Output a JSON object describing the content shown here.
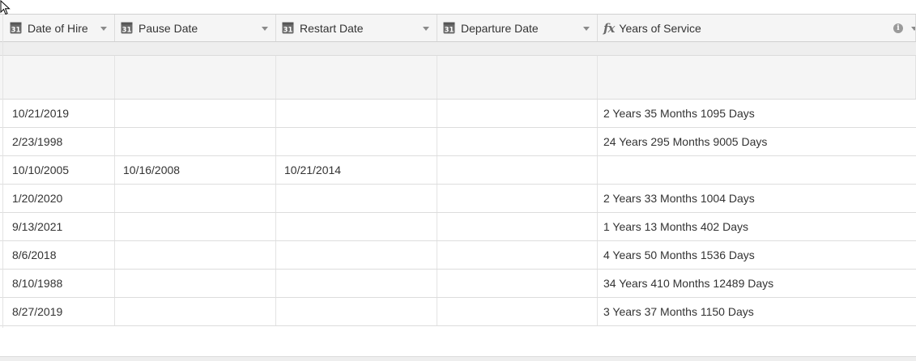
{
  "columns": [
    {
      "label": "Date of Hire",
      "icon": "calendar-icon",
      "icon_text": "31"
    },
    {
      "label": "Pause Date",
      "icon": "calendar-icon",
      "icon_text": "31"
    },
    {
      "label": "Restart Date",
      "icon": "calendar-icon",
      "icon_text": "31"
    },
    {
      "label": "Departure Date",
      "icon": "calendar-icon",
      "icon_text": "31"
    },
    {
      "label": "Years of Service",
      "icon": "formula-icon",
      "icon_text": "fx"
    }
  ],
  "info_icon_text": "i",
  "rows": [
    {
      "hire": "10/21/2019",
      "pause": "",
      "restart": "",
      "departure": "",
      "service": "2 Years 35 Months 1095 Days"
    },
    {
      "hire": "2/23/1998",
      "pause": "",
      "restart": "",
      "departure": "",
      "service": "24 Years 295 Months 9005 Days"
    },
    {
      "hire": "10/10/2005",
      "pause": "10/16/2008",
      "restart": "10/21/2014",
      "departure": "",
      "service": ""
    },
    {
      "hire": "1/20/2020",
      "pause": "",
      "restart": "",
      "departure": "",
      "service": "2 Years 33 Months 1004 Days"
    },
    {
      "hire": "9/13/2021",
      "pause": "",
      "restart": "",
      "departure": "",
      "service": "1 Years 13 Months 402 Days"
    },
    {
      "hire": "8/6/2018",
      "pause": "",
      "restart": "",
      "departure": "",
      "service": "4 Years 50 Months 1536 Days"
    },
    {
      "hire": "8/10/1988",
      "pause": "",
      "restart": "",
      "departure": "",
      "service": "34 Years 410 Months 12489 Days"
    },
    {
      "hire": "8/27/2019",
      "pause": "",
      "restart": "",
      "departure": "",
      "service": "3 Years 37 Months 1150 Days"
    }
  ],
  "colors": {
    "header_bg": "#f5f5f5",
    "group_bg": "#eeeeee",
    "border": "#dddddd",
    "text": "#333333",
    "icon": "#6a6a6a"
  }
}
